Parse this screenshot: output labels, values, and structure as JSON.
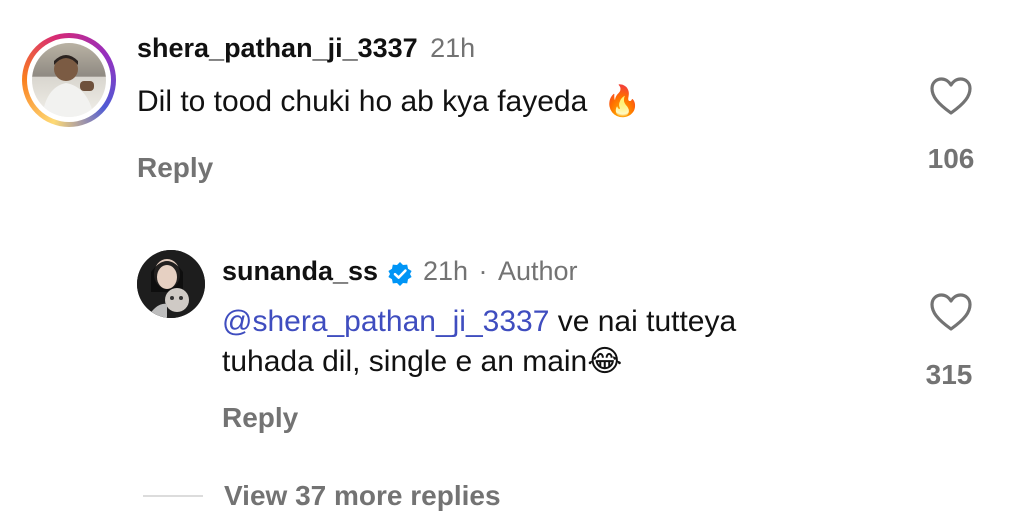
{
  "comments": [
    {
      "username": "shera_pathan_ji_3337",
      "time": "21h",
      "text": "Dil to tood chuki ho ab kya fayeda",
      "emoji": "🔥",
      "reply_label": "Reply",
      "likes": "106"
    },
    {
      "username": "sunanda_ss",
      "time": "21h",
      "separator": "·",
      "author_label": "Author",
      "mention": "@shera_pathan_ji_3337",
      "text_line1": " ve nai tutteya",
      "text_line2": "tuhada dil, single e an main",
      "emoji": "😂",
      "reply_label": "Reply",
      "likes": "315"
    }
  ],
  "view_more": "View 37 more replies",
  "colors": {
    "mention": "#3f4dbf",
    "secondary_text": "#737373",
    "verified": "#0095f6"
  }
}
